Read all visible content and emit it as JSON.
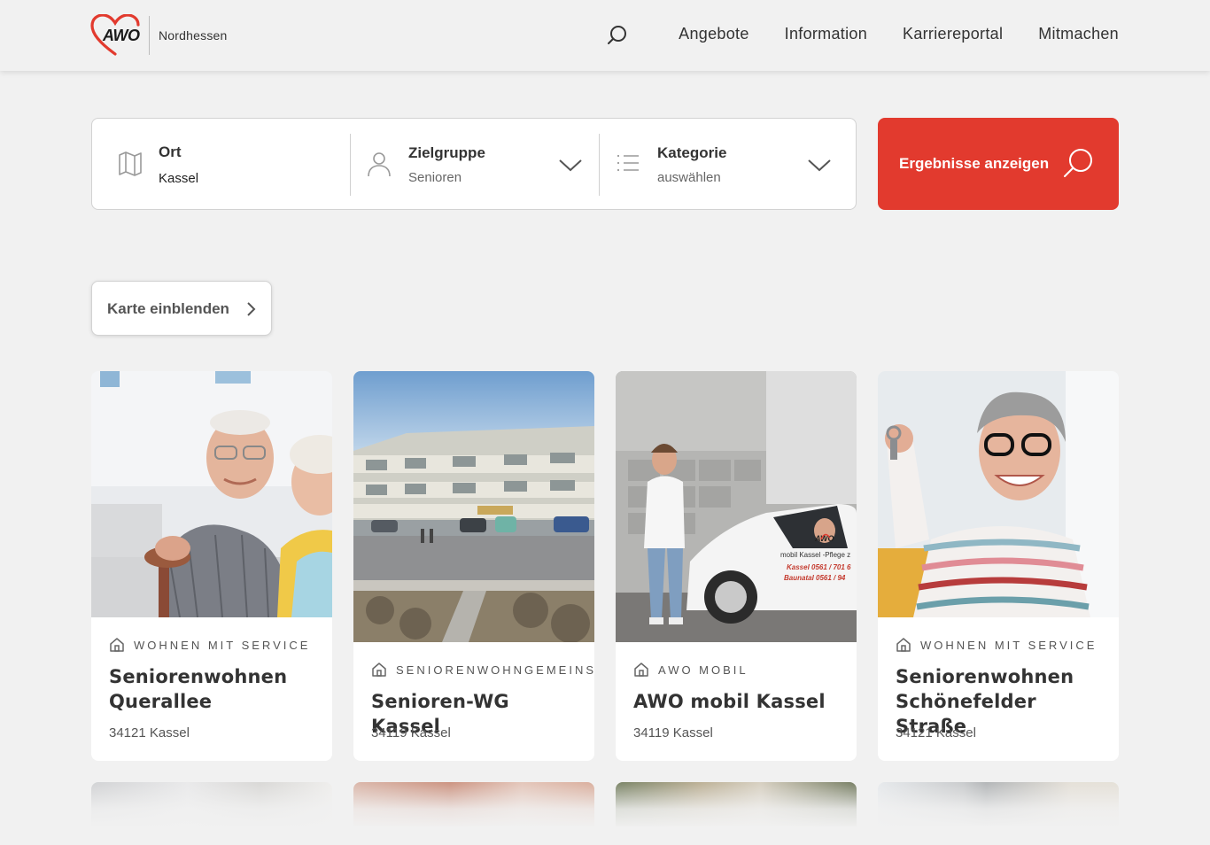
{
  "header": {
    "logo_text": "AWO",
    "region": "Nordhessen",
    "nav": [
      "Angebote",
      "Information",
      "Karriereportal",
      "Mitmachen"
    ]
  },
  "filter": {
    "ort": {
      "label": "Ort",
      "value": "Kassel"
    },
    "zielgruppe": {
      "label": "Zielgruppe",
      "value": "Senioren"
    },
    "kategorie": {
      "label": "Kategorie",
      "value": "auswählen"
    }
  },
  "cta": {
    "label": "Ergebnisse anzeigen"
  },
  "map_button": {
    "label": "Karte einblenden"
  },
  "cards": [
    {
      "category": "WOHNEN MIT SERVICE",
      "title": "Seniorenwohnen Querallee",
      "address": "34121 Kassel"
    },
    {
      "category": "SENIORENWOHNGEMEINSC",
      "title": "Senioren-WG Kassel",
      "address": "34119 Kassel"
    },
    {
      "category": "AWO MOBIL",
      "title": "AWO mobil Kassel",
      "address": "34119 Kassel"
    },
    {
      "category": "WOHNEN MIT SERVICE",
      "title": "Seniorenwohnen Schönefelder Straße",
      "address": "34121 Kassel"
    }
  ],
  "van_text": {
    "brand": "AWO",
    "line1": "mobil Kassel -Pflege z",
    "line2": "Kassel 0561 / 701 6",
    "line3": "Baunatal 0561 / 94"
  },
  "colors": {
    "accent": "#e23a2e",
    "background": "#f1f1f1",
    "text": "#333333"
  }
}
